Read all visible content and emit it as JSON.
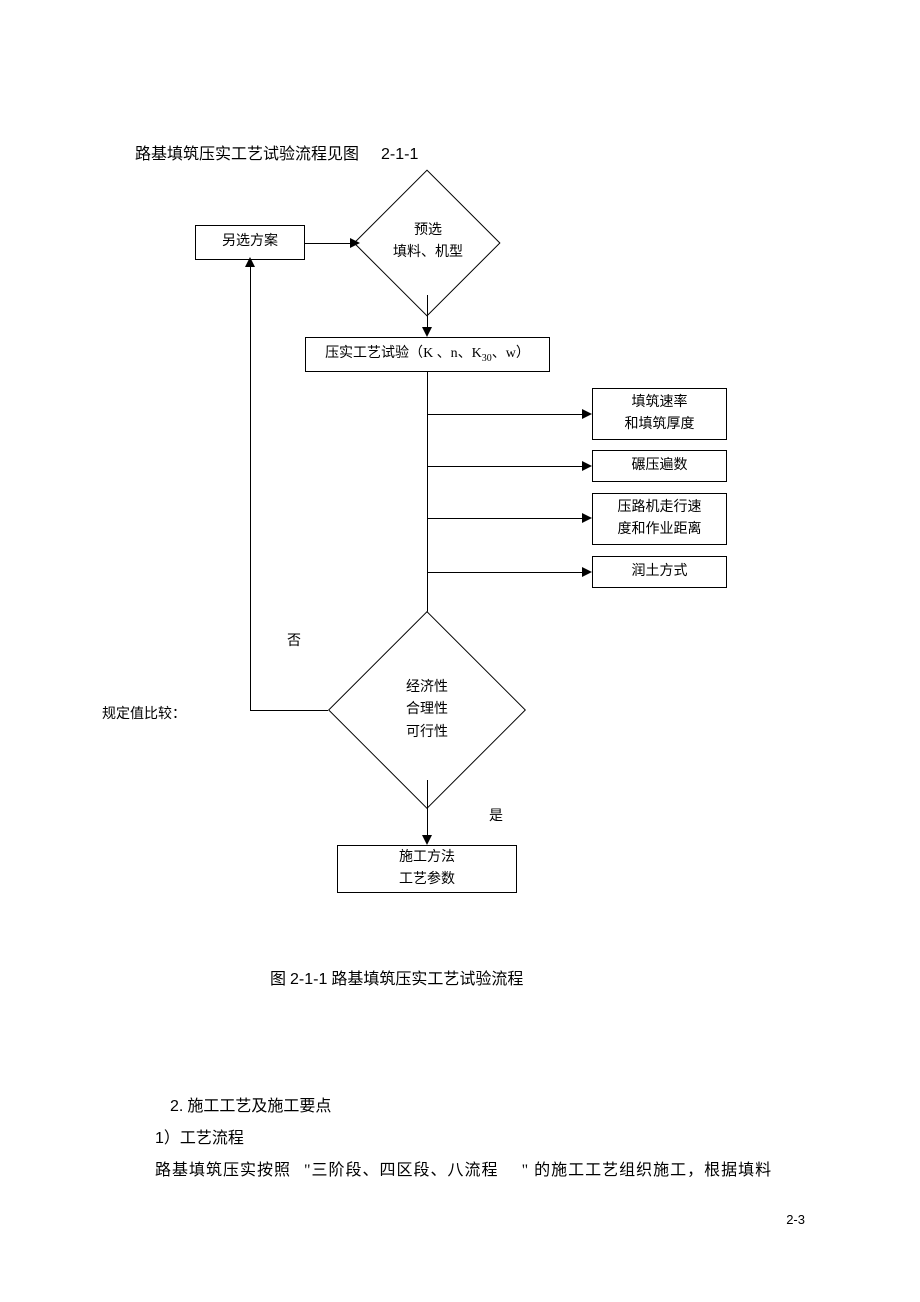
{
  "header": {
    "text": "路基填筑压实工艺试验流程见图",
    "figure_ref": "2-1-1"
  },
  "chart_data": {
    "type": "flowchart",
    "nodes": [
      {
        "id": "alt",
        "shape": "rect",
        "text": "另选方案"
      },
      {
        "id": "preselect",
        "shape": "diamond",
        "text1": "预选",
        "text2": "填料、机型"
      },
      {
        "id": "test",
        "shape": "rect",
        "text_prefix": "压实工艺试验（",
        "params": "K 、n、K",
        "sub": "30",
        "suffix": "、w）"
      },
      {
        "id": "out1",
        "shape": "rect",
        "text1": "填筑速率",
        "text2": "和填筑厚度"
      },
      {
        "id": "out2",
        "shape": "rect",
        "text": "碾压遍数"
      },
      {
        "id": "out3",
        "shape": "rect",
        "text1": "压路机走行速",
        "text2": "度和作业距离"
      },
      {
        "id": "out4",
        "shape": "rect",
        "text": "润土方式"
      },
      {
        "id": "decision",
        "shape": "diamond",
        "text1": "经济性",
        "text2": "合理性",
        "text3": "可行性"
      },
      {
        "id": "result",
        "shape": "rect",
        "text1": "施工方法",
        "text2": "工艺参数"
      }
    ],
    "labels": {
      "no": "否",
      "yes": "是",
      "compare": "规定值比较："
    }
  },
  "caption": {
    "prefix": "图 ",
    "num": "2-1-1",
    "text": " 路基填筑压实工艺试验流程"
  },
  "section": {
    "num": "2.",
    "title": " 施工工艺及施工要点"
  },
  "subitem": {
    "num": "1",
    "text": "）工艺流程"
  },
  "body": {
    "line1_a": "路基填筑压实按照",
    "line1_b": "\"三阶段、四区段、八流程",
    "line1_c": "\"",
    "line1_d": " 的施工工艺组织施工，根据填料"
  },
  "page_number": "2-3"
}
